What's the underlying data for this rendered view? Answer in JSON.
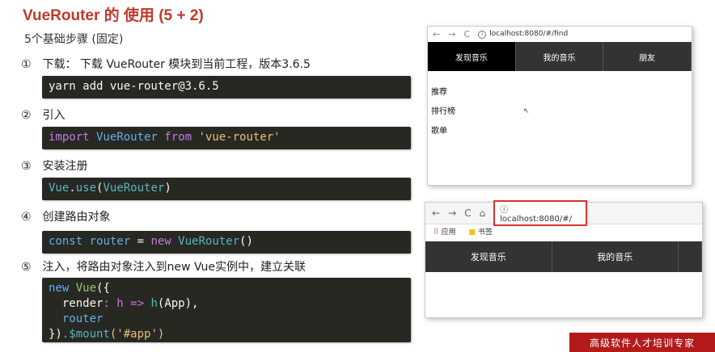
{
  "title": "VueRouter 的 使用 (5 + 2)",
  "subtitle": "5个基础步骤 (固定)",
  "steps": [
    {
      "num": "①",
      "text": "下载： 下载 VueRouter 模块到当前工程，版本3.6.5"
    },
    {
      "num": "②",
      "text": "引入"
    },
    {
      "num": "③",
      "text": "安装注册"
    },
    {
      "num": "④",
      "text": "创建路由对象"
    },
    {
      "num": "⑤",
      "text": "注入，将路由对象注入到new Vue实例中，建立关联"
    }
  ],
  "code": {
    "c1": "yarn add vue-router@3.6.5",
    "c2": {
      "a": "import",
      "b": " VueRouter ",
      "c": "from",
      "d": " 'vue-router'"
    },
    "c3": {
      "a": "Vue",
      "b": ".",
      "c": "use",
      "d": "(",
      "e": "VueRouter",
      "f": ")"
    },
    "c4": {
      "a": "const",
      "b": " router ",
      "c": "= ",
      "d": "new",
      "e": " VueRouter",
      "f": "()"
    },
    "c5": {
      "l1a": "new",
      "l1b": " Vue",
      "l1c": "({",
      "l2a": "  render",
      "l2b": ": h => ",
      "l2c": "h",
      "l2d": "(App),",
      "l3": "  router",
      "l4a": "})",
      "l4b": ".$mount",
      "l4c": "('#app')"
    }
  },
  "browser1": {
    "url": "localhost:8080/#/find",
    "tabs": [
      "发现音乐",
      "我的音乐",
      "朋友"
    ],
    "list": [
      "推荐",
      "排行榜",
      "歌单"
    ]
  },
  "browser2": {
    "url": "localhost:8080/#/",
    "bookmarks": [
      "应用",
      "书签"
    ],
    "tabs": [
      "发现音乐",
      "我的音乐",
      ""
    ]
  },
  "watermark": "高级软件人才培训专家"
}
